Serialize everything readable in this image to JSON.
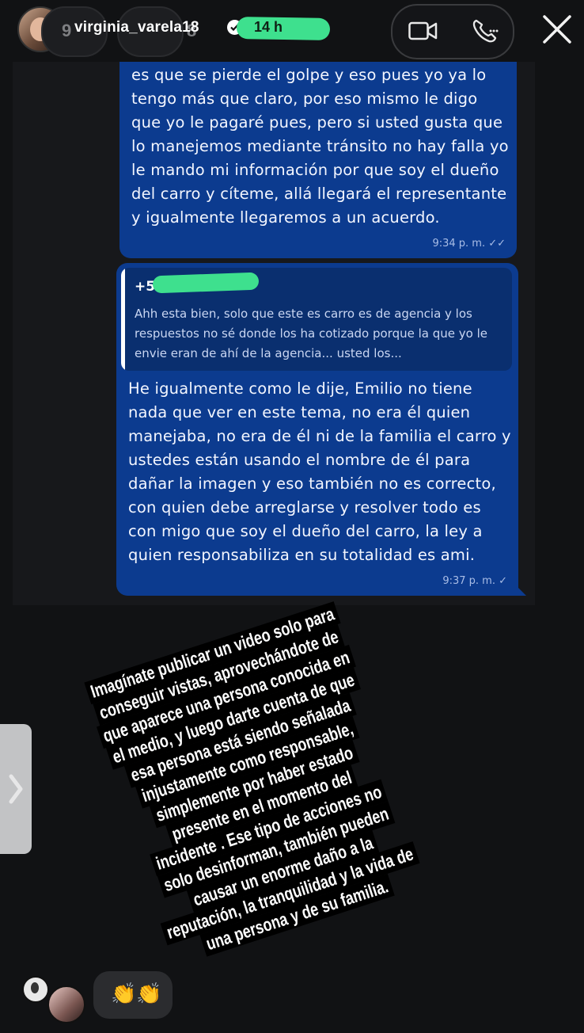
{
  "header": {
    "username": "virginia_varela18",
    "time_ago": "14 h",
    "ghost_text_1": "9",
    "ghost_text_2": "8"
  },
  "embedded_chat": {
    "message_1": {
      "text": "es que se pierde el golpe y eso pues yo ya lo tengo más que claro, por eso mismo le digo que yo le pagaré pues, pero si usted gusta que lo manejemos mediante tránsito no hay falla yo le mando mi información por que soy el dueño del carro y cíteme, allá llegará el representante y igualmente llegaremos a un acuerdo.",
      "time": "9:34 p. m. ✓✓"
    },
    "message_2": {
      "quoted_number": "+5",
      "quoted_text": "Ahh esta bien, solo que este es carro es de agencia y los respuestos no sé donde los ha cotizado porque la que yo le envie eran de ahí de la agencia... usted los...",
      "text": "He igualmente como le dije, Emilio no tiene nada que ver en este tema, no era él quien manejaba, no era de él ni de la familia el carro y ustedes están usando el nombre de él para dañar la imagen y eso también no es correcto, con quien debe arreglarse y resolver todo es con migo que soy el dueño del carro, la ley a quien responsabiliza en su totalidad es ami.",
      "time": "9:37 p. m. ✓"
    }
  },
  "story_text": {
    "lines": [
      "Imagínate publicar un video solo para",
      "conseguir vistas, aprovechándote de",
      "que aparece una persona conocida en",
      "el medio, y luego darte cuenta de que",
      "esa persona está siendo señalada",
      "injustamente como responsable,",
      "simplemente por haber estado",
      "presente en el momento del",
      "incidente . Ese tipo de acciones no",
      "solo desinforman, también pueden",
      "causar un enorme daño a la",
      "reputación, la tranquilidad y la vida de",
      "una persona y de su familia."
    ]
  },
  "reactions": {
    "emoji": "👏👏"
  },
  "icons": {
    "video": "video-camera-icon",
    "phone": "phone-icon",
    "close": "close-icon",
    "prev": "chevron-right-icon",
    "verified": "verified-badge-icon"
  },
  "colors": {
    "bubble": "#0c3b8f",
    "highlight": "#3ee08e",
    "background": "#111214"
  }
}
